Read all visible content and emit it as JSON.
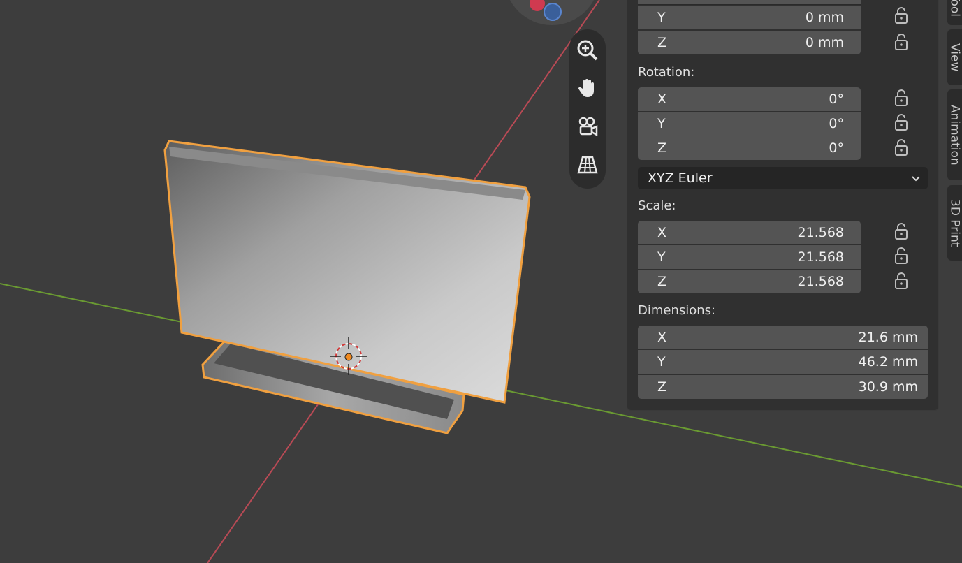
{
  "app": "3D Viewport",
  "nav_tools": [
    {
      "name": "zoom-icon"
    },
    {
      "name": "hand-pan-icon"
    },
    {
      "name": "camera-view-icon"
    },
    {
      "name": "grid-ortho-icon"
    }
  ],
  "properties": {
    "location": {
      "y": {
        "axis": "Y",
        "value": "0 mm"
      },
      "z": {
        "axis": "Z",
        "value": "0 mm"
      }
    },
    "rotation": {
      "label": "Rotation:",
      "x": {
        "axis": "X",
        "value": "0°"
      },
      "y": {
        "axis": "Y",
        "value": "0°"
      },
      "z": {
        "axis": "Z",
        "value": "0°"
      }
    },
    "rotation_mode": "XYZ Euler",
    "scale": {
      "label": "Scale:",
      "x": {
        "axis": "X",
        "value": "21.568"
      },
      "y": {
        "axis": "Y",
        "value": "21.568"
      },
      "z": {
        "axis": "Z",
        "value": "21.568"
      }
    },
    "dimensions": {
      "label": "Dimensions:",
      "x": {
        "axis": "X",
        "value": "21.6 mm"
      },
      "y": {
        "axis": "Y",
        "value": "46.2 mm"
      },
      "z": {
        "axis": "Z",
        "value": "30.9 mm"
      }
    }
  },
  "side_tabs": [
    {
      "label": "Tool"
    },
    {
      "label": "View"
    },
    {
      "label": "Animation"
    },
    {
      "label": "3D Print"
    }
  ],
  "colors": {
    "background": "#3d3d3d",
    "selection_outline": "#f0a040",
    "x_axis": "#b84a55",
    "y_axis": "#6a9a32",
    "panel": "#303030",
    "field": "#545454"
  }
}
